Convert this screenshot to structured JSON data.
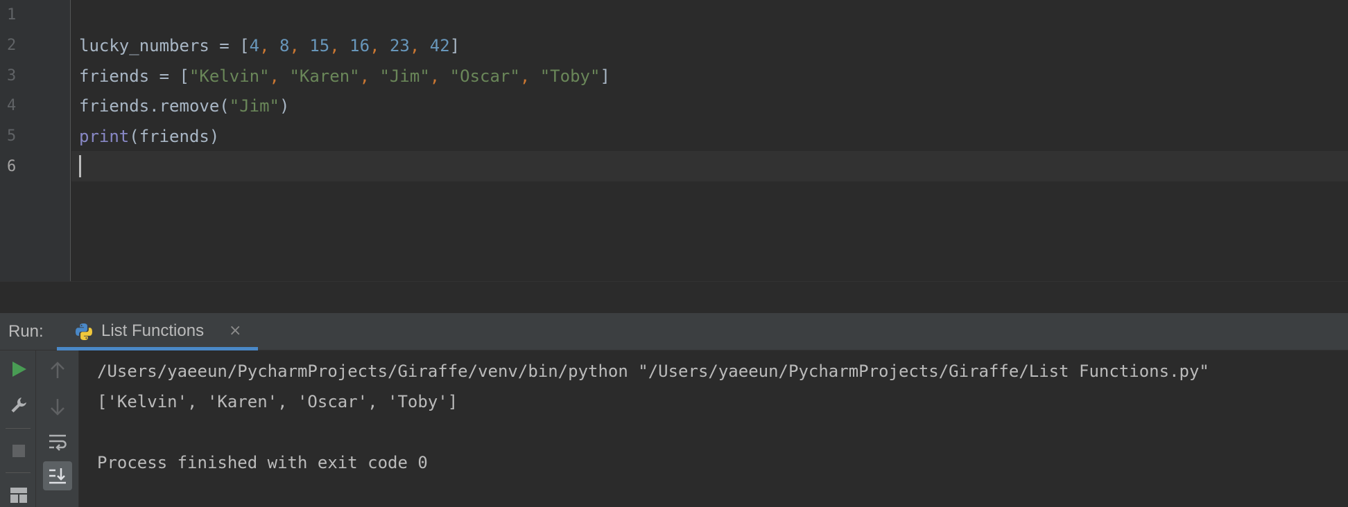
{
  "editor": {
    "line_numbers": [
      "1",
      "2",
      "3",
      "4",
      "5",
      "6"
    ],
    "lines": {
      "l2": {
        "var": "lucky_numbers",
        "assign": " = [",
        "n1": "4",
        "n2": "8",
        "n3": "15",
        "n4": "16",
        "n5": "23",
        "n6": "42",
        "comma": ",",
        "close": "]"
      },
      "l3": {
        "var": "friends",
        "assign": " = [",
        "s1": "\"Kelvin\"",
        "s2": "\"Karen\"",
        "s3": "\"Jim\"",
        "s4": "\"Oscar\"",
        "s5": "\"Toby\"",
        "comma": ",",
        "close": "]"
      },
      "l4": {
        "call": "friends.remove(",
        "arg": "\"Jim\"",
        "close": ")"
      },
      "l5": {
        "fn": "print",
        "args": "(friends)"
      }
    }
  },
  "run": {
    "label": "Run:",
    "tab_label": "List Functions",
    "tab_close": "×",
    "output": [
      "/Users/yaeeun/PycharmProjects/Giraffe/venv/bin/python \"/Users/yaeeun/PycharmProjects/Giraffe/List Functions.py\"",
      "['Kelvin', 'Karen', 'Oscar', 'Toby']",
      "",
      "Process finished with exit code 0"
    ]
  },
  "colors": {
    "editor_bg": "#2b2b2b",
    "gutter_bg": "#313335",
    "panel_bg": "#3c3f41",
    "number": "#6897bb",
    "string": "#6a8759",
    "comma": "#cc7832",
    "builtin": "#8888c6",
    "run_green": "#499c54",
    "tab_underline": "#4a88c7"
  },
  "icons": [
    "python-icon",
    "run-icon",
    "wrench-icon",
    "stop-icon",
    "layout-icon",
    "up-arrow-icon",
    "down-arrow-icon",
    "soft-wrap-icon",
    "scroll-to-end-icon",
    "close-icon"
  ]
}
